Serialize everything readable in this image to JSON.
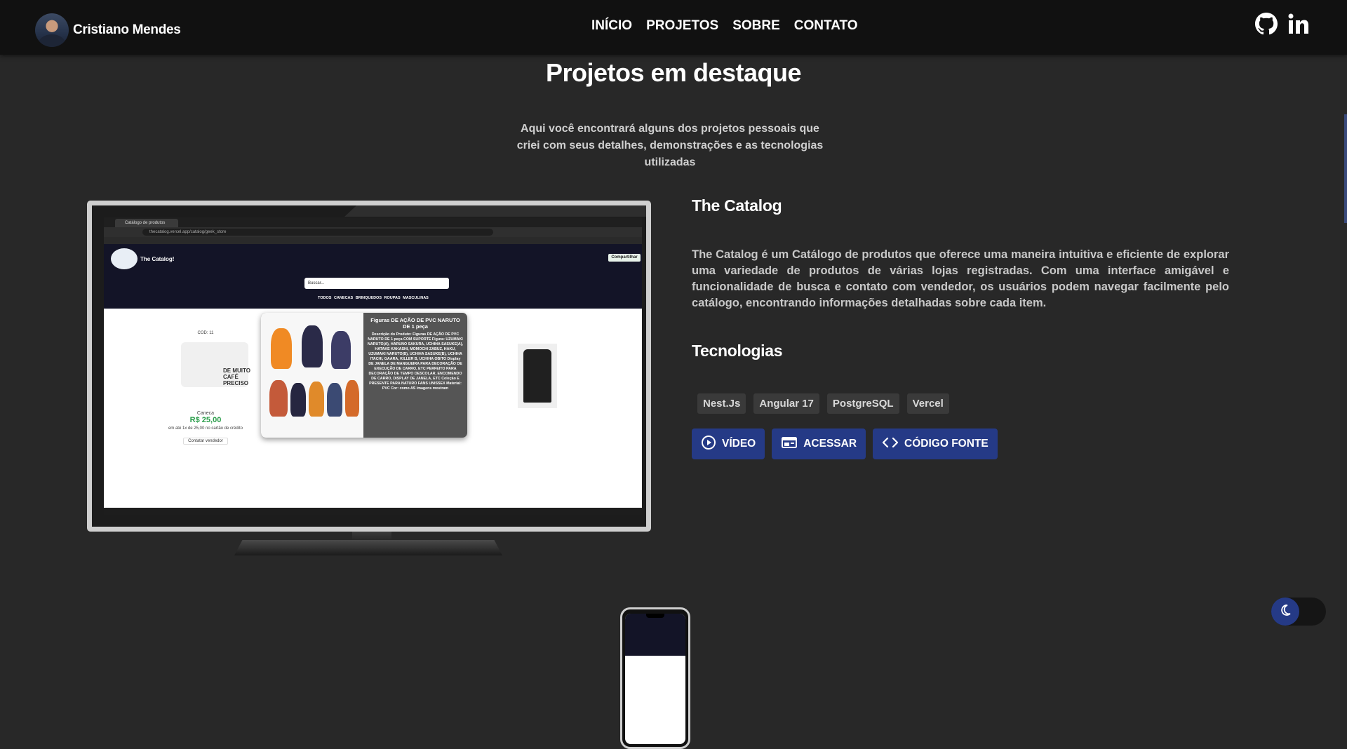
{
  "header": {
    "brand_name": "Cristiano Mendes",
    "nav": [
      "INÍCIO",
      "PROJETOS",
      "SOBRE",
      "CONTATO"
    ],
    "social_icons": [
      "github-icon",
      "linkedin-icon"
    ]
  },
  "section": {
    "title": "Projetos em destaque",
    "subtitle": "Aqui você encontrará alguns dos projetos pessoais que criei com seus detalhes, demonstrações e as tecnologias utilizadas"
  },
  "mockup": {
    "tab_title": "Catálogo de produtos",
    "url": "thecatalog.vercel.app/catalog/geek_store",
    "site_name": "The Catalog!",
    "share_label": "Compartilhar",
    "search_placeholder": "Buscar...",
    "categories": "TODOS CANECAS BRINQUEDOS ROUPAS MASCULINAS",
    "product1": {
      "code": "COD: 11",
      "name": "Caneca",
      "price": "R$ 25,00",
      "note": "em até 1x de 25,00 no cartão de crédito",
      "contact": "Contatar vendedor"
    },
    "popup_title": "Figuras DE AÇÃO DE PVC NARUTO DE 1 peça",
    "popup_desc": "Descrição do Produto: Figuras DE AÇÃO DE PVC NARUTO DE 1 peça COM SUPORTE Figura: UZUMAKI NARUTO(A), HARUNO SAKURA, UCHIHA SASUKE(A), HATAKE KAKASHI, MOMOCHI ZABUZ, HAKU, UZUMAKI NARUTO(B), UCHIHA SASUKE(B), UCHIHA ITACHI, GAARA, KILLER B, UCHIHA OBITO Display DE JANELA DE MANGUEIRA PARA DECORAÇÃO DE EXECUÇÃO DE CARRO, ETC PERFEITO PARA DECORAÇÃO DE TEMPO DESCOLAR, ENCOMENDO DE CARRO, DISPLAY DE JANELA, ETC Coleção E PRESENTE PARA NATURO FANS UNISSEX Material: PVC Cor: como AS imagens mostram"
  },
  "project": {
    "title": "The Catalog",
    "description": "The Catalog é um Catálogo de produtos que oferece uma maneira intuitiva e eficiente de explorar uma variedade de produtos de várias lojas registradas. Com uma interface amigável e funcionalidade de busca e contato com vendedor, os usuários podem navegar facilmente pelo catálogo, encontrando informações detalhadas sobre cada item.",
    "tech_title": "Tecnologias",
    "technologies": [
      "Nest.Js",
      "Angular 17",
      "PostgreSQL",
      "Vercel"
    ],
    "actions": [
      {
        "label": "VÍDEO",
        "icon": "play-icon"
      },
      {
        "label": "ACESSAR",
        "icon": "browser-icon"
      },
      {
        "label": "CÓDIGO FONTE",
        "icon": "code-icon"
      }
    ]
  },
  "theme_toggle": {
    "icon": "moon-icon"
  },
  "colors": {
    "accent": "#253a86",
    "background": "#282828",
    "navbar": "#111111"
  }
}
